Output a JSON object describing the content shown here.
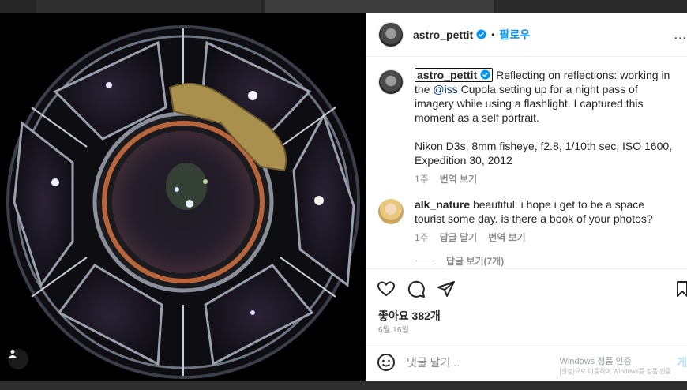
{
  "post": {
    "username": "astro_pettit",
    "follow_label": "팔로우",
    "dot": "•",
    "more_label": "..."
  },
  "caption": {
    "username": "astro_pettit",
    "text_before_mention": "Reflecting on reflections: working in the",
    "mention": "@iss",
    "text_after_mention": "Cupola setting up for a night pass of imagery while using a flashlight. I captured this moment as a self portrait.",
    "details": "Nikon D3s, 8mm fisheye, f2.8, 1/10th sec, ISO 1600, Expedition 30, 2012",
    "time": "1주",
    "translate_label": "번역 보기"
  },
  "comments": [
    {
      "username": "alk_nature",
      "text": "beautiful. i hope i get to be a space tourist some day. is there a book of your photos?",
      "time": "1주",
      "reply_label": "답글 달기",
      "translate_label": "번역 보기",
      "view_replies_label": "답글 보기(7개)"
    }
  ],
  "engagement": {
    "likes_label": "좋아요 382개",
    "date": "6월 16일"
  },
  "composer": {
    "placeholder": "댓글 달기...",
    "post_label": "게"
  },
  "os_watermark": {
    "line1": "Windows 정품 인증",
    "line2": "[설정]으로 이동하여 Windows를 정품 인증"
  },
  "icons": [
    "verified-badge-icon",
    "heart-icon",
    "comment-icon",
    "share-icon",
    "bookmark-icon",
    "emoji-icon",
    "user-tag-icon"
  ],
  "colors": {
    "link_blue": "#0095f6",
    "mention_blue": "#00376b",
    "muted": "#8e8e8e"
  }
}
